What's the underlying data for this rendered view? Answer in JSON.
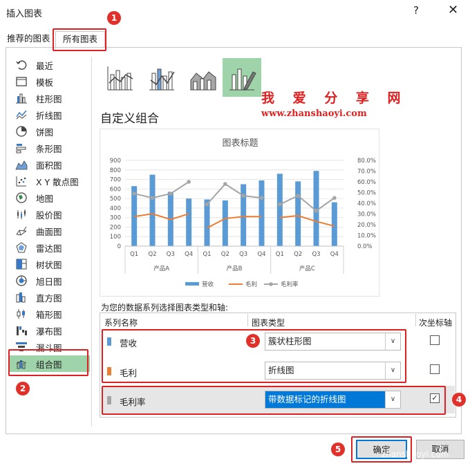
{
  "window": {
    "title": "插入图表",
    "help": "?",
    "close": "✕"
  },
  "tabs": [
    {
      "label": "推荐的图表"
    },
    {
      "label": "所有图表"
    }
  ],
  "sidebar": {
    "items": [
      {
        "label": "最近",
        "icon": "recent-icon"
      },
      {
        "label": "模板",
        "icon": "template-icon"
      },
      {
        "label": "柱形图",
        "icon": "column-chart-icon"
      },
      {
        "label": "折线图",
        "icon": "line-chart-icon"
      },
      {
        "label": "饼图",
        "icon": "pie-chart-icon"
      },
      {
        "label": "条形图",
        "icon": "bar-chart-icon"
      },
      {
        "label": "面积图",
        "icon": "area-chart-icon"
      },
      {
        "label": "X Y 散点图",
        "icon": "scatter-chart-icon"
      },
      {
        "label": "地图",
        "icon": "map-chart-icon"
      },
      {
        "label": "股价图",
        "icon": "stock-chart-icon"
      },
      {
        "label": "曲面图",
        "icon": "surface-chart-icon"
      },
      {
        "label": "雷达图",
        "icon": "radar-chart-icon"
      },
      {
        "label": "树状图",
        "icon": "treemap-chart-icon"
      },
      {
        "label": "旭日图",
        "icon": "sunburst-chart-icon"
      },
      {
        "label": "直方图",
        "icon": "histogram-chart-icon"
      },
      {
        "label": "箱形图",
        "icon": "box-chart-icon"
      },
      {
        "label": "瀑布图",
        "icon": "waterfall-chart-icon"
      },
      {
        "label": "漏斗图",
        "icon": "funnel-chart-icon"
      },
      {
        "label": "组合图",
        "icon": "combo-chart-icon"
      }
    ]
  },
  "combo_title": "自定义组合",
  "watermark": {
    "title": "我 爱 分 享 网",
    "url": "www.zhanshaoyi.com",
    "footer": "zhanshaoyi.com"
  },
  "series_caption": "为您的数据系列选择图表类型和轴:",
  "series_table": {
    "headers": {
      "name": "系列名称",
      "type": "图表类型",
      "secondary": "次坐标轴"
    },
    "rows": [
      {
        "name": "营收",
        "color": "#5b9bd5",
        "type": "簇状柱形图",
        "secondary": false
      },
      {
        "name": "毛利",
        "color": "#ed7d31",
        "type": "折线图",
        "secondary": false
      },
      {
        "name": "毛利率",
        "color": "#a5a5a5",
        "type": "带数据标记的折线图",
        "secondary": true
      }
    ]
  },
  "buttons": {
    "ok": "确定",
    "cancel": "取消"
  },
  "badges": [
    "1",
    "2",
    "3",
    "4",
    "5"
  ],
  "chart_data": {
    "type": "bar",
    "title": "图表标题",
    "categories": [
      "Q1",
      "Q2",
      "Q3",
      "Q4",
      "Q1",
      "Q2",
      "Q3",
      "Q4",
      "Q1",
      "Q2",
      "Q3",
      "Q4"
    ],
    "groups": [
      "产品A",
      "产品B",
      "产品C"
    ],
    "y_ticks": [
      "900",
      "800",
      "700",
      "600",
      "500",
      "400",
      "300",
      "200",
      "100",
      "0"
    ],
    "y2_ticks": [
      "80.0%",
      "70.0%",
      "60.0%",
      "50.0%",
      "40.0%",
      "30.0%",
      "20.0%",
      "10.0%",
      "0.0%"
    ],
    "ylim": [
      0,
      900
    ],
    "y2lim": [
      0,
      0.8
    ],
    "series": [
      {
        "name": "营收",
        "type": "bar",
        "color": "#5b9bd5",
        "values": [
          630,
          750,
          570,
          500,
          490,
          480,
          650,
          690,
          760,
          680,
          790,
          460
        ]
      },
      {
        "name": "毛利",
        "type": "line",
        "color": "#ed7d31",
        "values": [
          310,
          340,
          280,
          340,
          190,
          290,
          310,
          310,
          300,
          320,
          260,
          210
        ]
      },
      {
        "name": "毛利率",
        "type": "line-marker",
        "color": "#a5a5a5",
        "axis": "secondary",
        "values": [
          0.49,
          0.45,
          0.49,
          0.6,
          0.39,
          0.58,
          0.47,
          0.45,
          0.39,
          0.47,
          0.33,
          0.45
        ]
      }
    ]
  }
}
